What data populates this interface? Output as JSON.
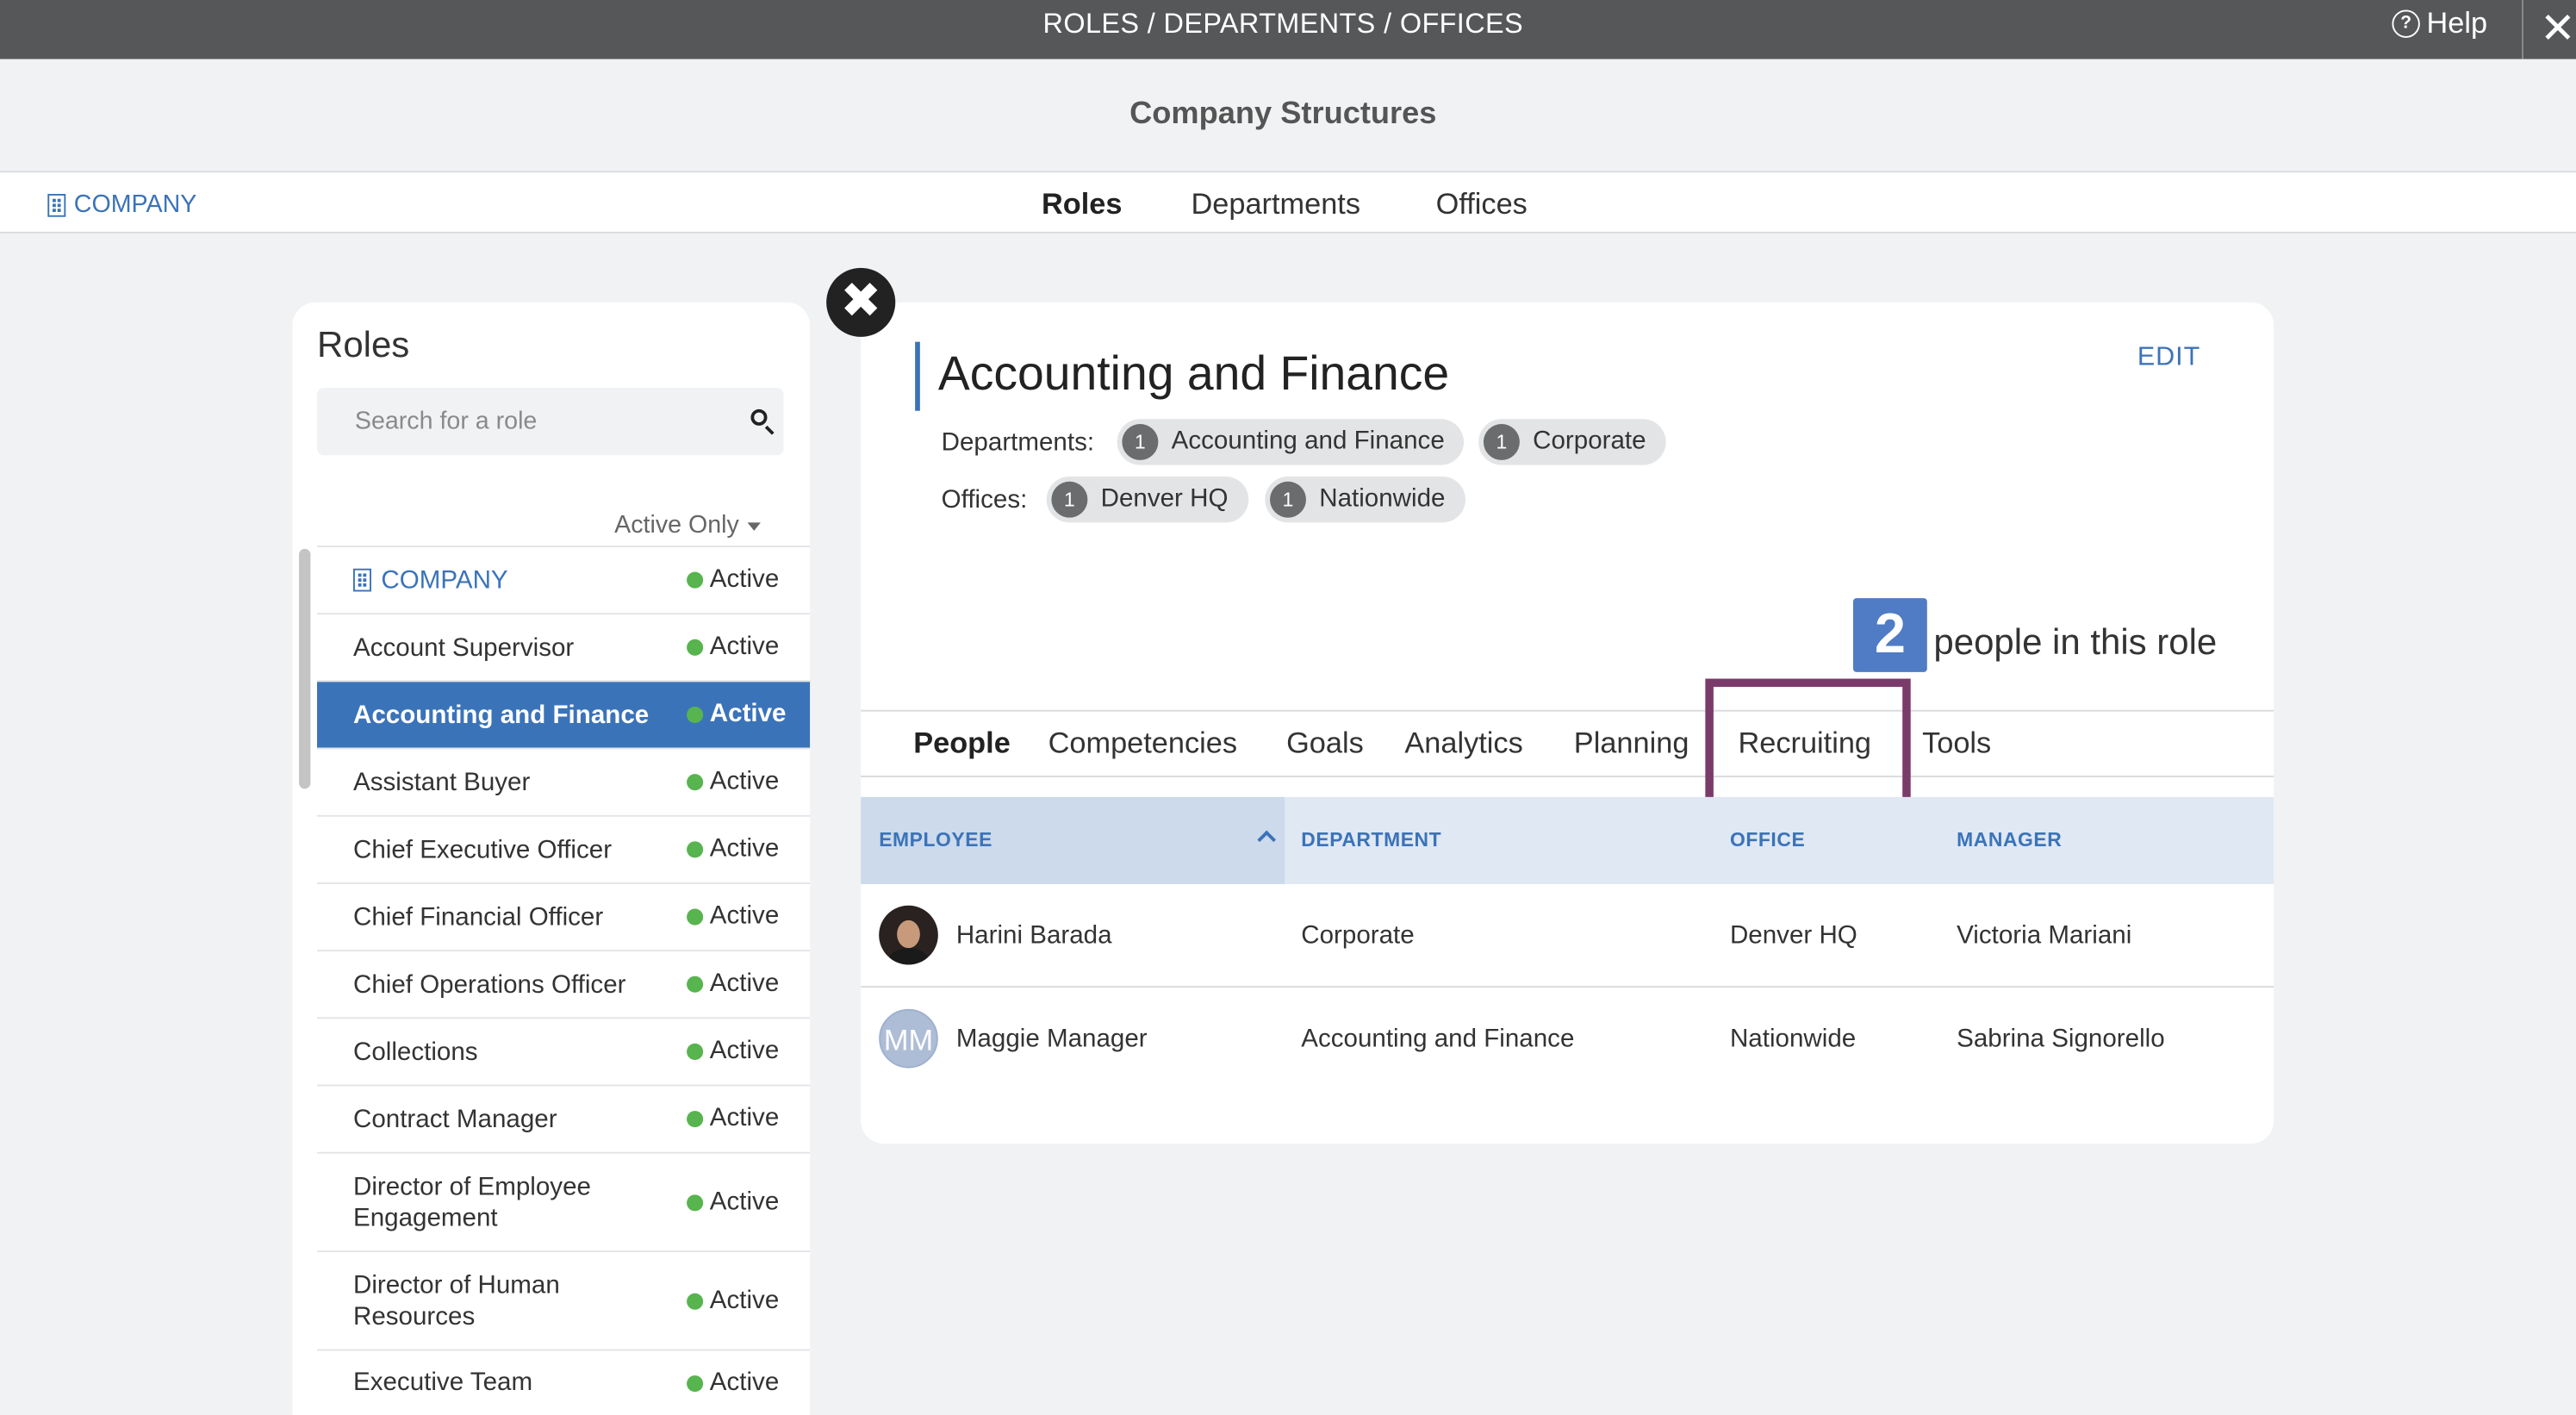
{
  "topbar": {
    "title": "ROLES / DEPARTMENTS / OFFICES",
    "help_label": "Help",
    "help_glyph": "?",
    "close_glyph": "✕"
  },
  "header": {
    "title": "Company Structures"
  },
  "nav": {
    "company_label": "COMPANY",
    "tabs": [
      {
        "label": "Roles",
        "active": true
      },
      {
        "label": "Departments"
      },
      {
        "label": "Offices"
      }
    ]
  },
  "roles_panel": {
    "title": "Roles",
    "search_placeholder": "Search for a role",
    "filter_label": "Active Only",
    "items": [
      {
        "label": "COMPANY",
        "status": "Active",
        "type": "company"
      },
      {
        "label": "Account Supervisor",
        "status": "Active"
      },
      {
        "label": "Accounting and Finance",
        "status": "Active",
        "selected": true
      },
      {
        "label": "Assistant Buyer",
        "status": "Active"
      },
      {
        "label": "Chief Executive Officer",
        "status": "Active"
      },
      {
        "label": "Chief Financial Officer",
        "status": "Active"
      },
      {
        "label": "Chief Operations Officer",
        "status": "Active"
      },
      {
        "label": "Collections",
        "status": "Active"
      },
      {
        "label": "Contract Manager",
        "status": "Active"
      },
      {
        "label": "Director of Employee Engagement",
        "status": "Active"
      },
      {
        "label": "Director of Human Resources",
        "status": "Active"
      },
      {
        "label": "Executive Team",
        "status": "Active"
      }
    ]
  },
  "detail": {
    "close_glyph": "✖",
    "title": "Accounting and Finance",
    "edit_label": "EDIT",
    "departments_label": "Departments:",
    "departments": [
      {
        "count": "1",
        "name": "Accounting and Finance"
      },
      {
        "count": "1",
        "name": "Corporate"
      }
    ],
    "offices_label": "Offices:",
    "offices": [
      {
        "count": "1",
        "name": "Denver HQ"
      },
      {
        "count": "1",
        "name": "Nationwide"
      }
    ],
    "people_count": "2",
    "people_label": "people in this role",
    "tabs": [
      {
        "label": "People",
        "active": true
      },
      {
        "label": "Competencies"
      },
      {
        "label": "Goals"
      },
      {
        "label": "Analytics"
      },
      {
        "label": "Planning"
      },
      {
        "label": "Recruiting",
        "highlighted": true
      },
      {
        "label": "Tools"
      }
    ],
    "columns": [
      "EMPLOYEE",
      "DEPARTMENT",
      "OFFICE",
      "MANAGER"
    ],
    "rows": [
      {
        "name": "Harini Barada",
        "department": "Corporate",
        "office": "Denver HQ",
        "manager": "Victoria Mariani",
        "avatar": "photo"
      },
      {
        "name": "Maggie Manager",
        "department": "Accounting and Finance",
        "office": "Nationwide",
        "manager": "Sabrina Signorello",
        "avatar": "initials",
        "initials": "MM"
      }
    ]
  },
  "colors": {
    "accent": "#3b73b9",
    "active_dot": "#57b44e",
    "highlight": "#7a3b6a",
    "topbar": "#555759"
  }
}
